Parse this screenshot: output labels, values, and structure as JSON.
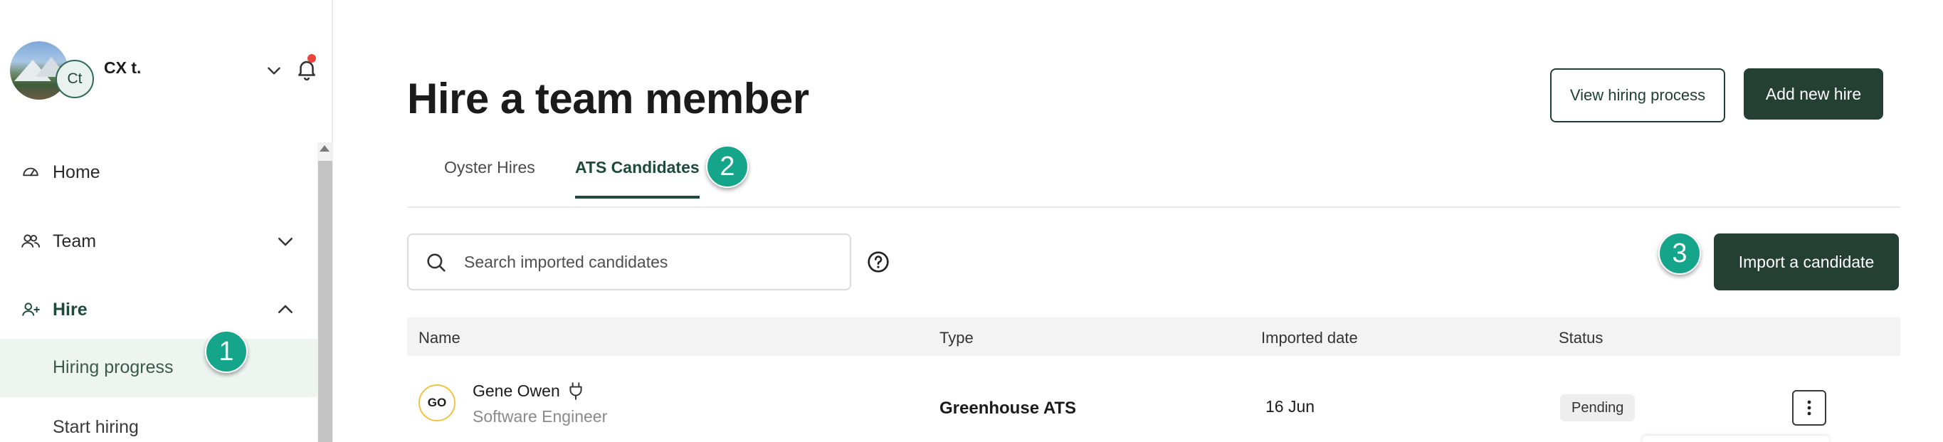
{
  "user": {
    "initials": "Ct",
    "name": "CX t."
  },
  "sidebar": {
    "items": [
      {
        "label": "Home",
        "icon": "dashboard-icon"
      },
      {
        "label": "Team",
        "icon": "people-icon"
      },
      {
        "label": "Hire",
        "icon": "add-person-icon"
      }
    ],
    "hire_subitems": [
      {
        "label": "Hiring progress"
      },
      {
        "label": "Start hiring"
      }
    ]
  },
  "annotations": [
    "1",
    "2",
    "3"
  ],
  "header": {
    "title": "Hire a team member",
    "view_process_label": "View hiring process",
    "add_hire_label": "Add new hire"
  },
  "tabs": [
    {
      "label": "Oyster Hires"
    },
    {
      "label": "ATS Candidates"
    }
  ],
  "search": {
    "placeholder": "Search imported candidates"
  },
  "import_label": "Import a candidate",
  "table": {
    "columns": [
      "Name",
      "Type",
      "Imported date",
      "Status"
    ],
    "rows": [
      {
        "initials": "GO",
        "name": "Gene Owen",
        "role": "Software Engineer",
        "type": "Greenhouse ATS",
        "date": "16 Jun",
        "status": "Pending"
      }
    ]
  },
  "colors": {
    "brand": "#243f33",
    "accent_badge": "#14a58a",
    "alert_dot": "#e8463a"
  }
}
